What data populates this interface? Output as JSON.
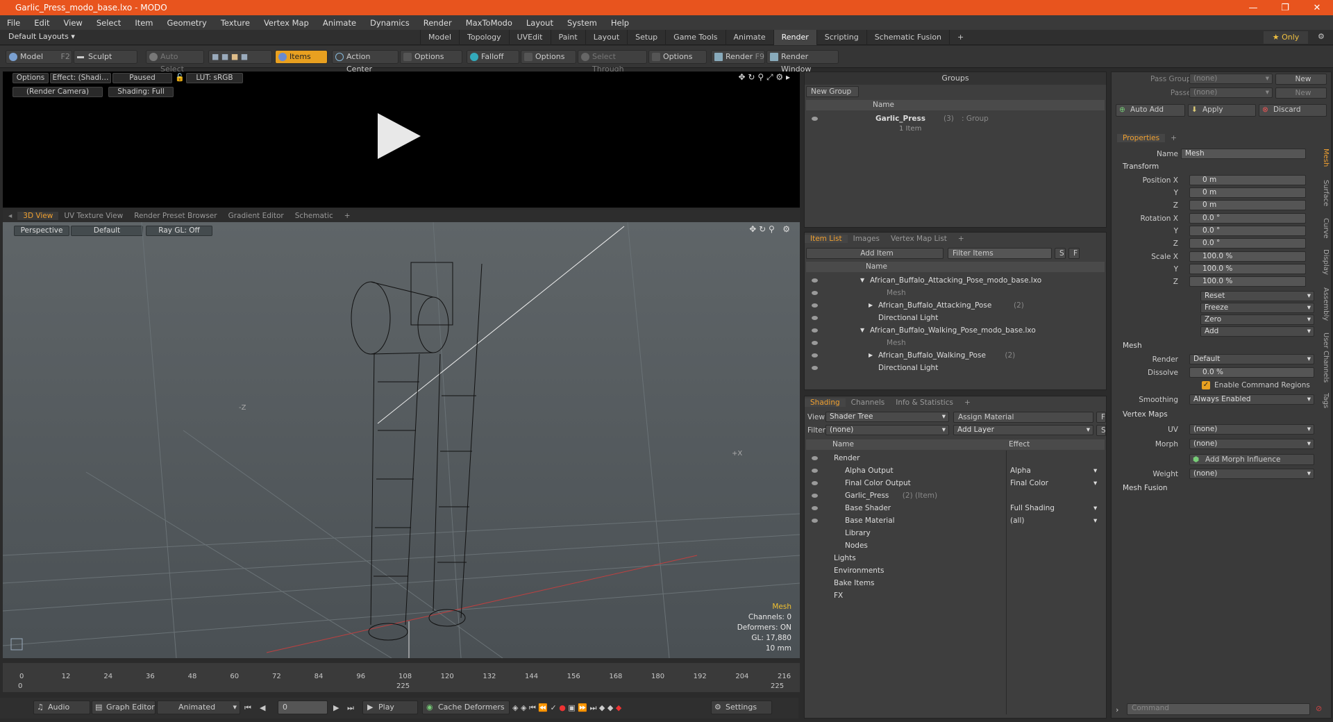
{
  "window": {
    "title": "Garlic_Press_modo_base.lxo - MODO",
    "controls": [
      "—",
      "❐",
      "✕"
    ]
  },
  "menu": [
    "File",
    "Edit",
    "View",
    "Select",
    "Item",
    "Geometry",
    "Texture",
    "Vertex Map",
    "Animate",
    "Dynamics",
    "Render",
    "MaxToModo",
    "Layout",
    "System",
    "Help"
  ],
  "layout": {
    "default": "Default Layouts",
    "tabs": [
      "Model",
      "Topology",
      "UVEdit",
      "Paint",
      "Layout",
      "Setup",
      "Game Tools",
      "Animate",
      "Render",
      "Scripting",
      "Schematic Fusion"
    ],
    "active_tab": "Render",
    "plus": "+",
    "only": "Only"
  },
  "toolbar": {
    "model": "Model",
    "model_key": "F2",
    "sculpt": "Sculpt",
    "auto_select": "Auto Select",
    "items": "Items",
    "action_center": "Action Center",
    "options1": "Options",
    "falloff": "Falloff",
    "options2": "Options",
    "select_through": "Select Through",
    "options3": "Options",
    "render": "Render",
    "render_key": "F9",
    "render_window": "Render Window"
  },
  "render_view": {
    "options": "Options",
    "effect": "Effect: (Shadi…",
    "paused": "Paused",
    "lut": "LUT: sRGB",
    "camera": "(Render Camera)",
    "shading": "Shading: Full"
  },
  "viewport_tabs": [
    "3D View",
    "UV Texture View",
    "Render Preset Browser",
    "Gradient Editor",
    "Schematic",
    "+"
  ],
  "view3d": {
    "perspective": "Perspective",
    "default": "Default",
    "raygl": "Ray GL: Off",
    "hud": {
      "item": "Mesh",
      "channels": "Channels: 0",
      "deformers": "Deformers: ON",
      "gl": "GL: 17,880",
      "size": "10 mm"
    }
  },
  "timeline": {
    "ticks": [
      "0",
      "12",
      "24",
      "36",
      "48",
      "60",
      "72",
      "84",
      "96",
      "108",
      "120",
      "132",
      "144",
      "156",
      "168",
      "180",
      "192",
      "204",
      "216"
    ],
    "start": "0",
    "mid": "225",
    "end": "225"
  },
  "bottombar": {
    "audio": "Audio",
    "graph_editor": "Graph Editor",
    "animated": "Animated",
    "frame": "0",
    "play": "Play",
    "cache": "Cache Deformers",
    "settings": "Settings"
  },
  "groups": {
    "title": "Groups",
    "new_group": "New Group",
    "col_name": "Name",
    "item_name": "Garlic_Press",
    "item_count": "(3)",
    "item_type": ": Group",
    "item_sub": "1 Item"
  },
  "item_list": {
    "tabs": [
      "Item List",
      "Images",
      "Vertex Map List",
      "+"
    ],
    "add_item": "Add Item",
    "filter": "Filter Items",
    "s": "S",
    "f": "F",
    "col_name": "Name",
    "rows": [
      {
        "label": "African_Buffalo_Attacking_Pose_modo_base.lxo",
        "indent": 0,
        "dim": false,
        "exp": "▼"
      },
      {
        "label": "Mesh",
        "indent": 2,
        "dim": true,
        "exp": ""
      },
      {
        "label": "African_Buffalo_Attacking_Pose",
        "suffix": "(2)",
        "indent": 1,
        "dim": false,
        "exp": "▶"
      },
      {
        "label": "Directional Light",
        "indent": 1,
        "dim": false,
        "exp": ""
      },
      {
        "label": "African_Buffalo_Walking_Pose_modo_base.lxo",
        "indent": 0,
        "dim": false,
        "exp": "▼"
      },
      {
        "label": "Mesh",
        "indent": 2,
        "dim": true,
        "exp": ""
      },
      {
        "label": "African_Buffalo_Walking_Pose",
        "suffix": "(2)",
        "indent": 1,
        "dim": false,
        "exp": "▶"
      },
      {
        "label": "Directional Light",
        "indent": 1,
        "dim": false,
        "exp": ""
      }
    ]
  },
  "shading": {
    "tabs": [
      "Shading",
      "Channels",
      "Info & Statistics",
      "+"
    ],
    "view_label": "View",
    "view_value": "Shader Tree",
    "assign": "Assign Material",
    "f": "F",
    "filter_label": "Filter",
    "filter_value": "(none)",
    "add_layer": "Add Layer",
    "s": "S",
    "col_name": "Name",
    "col_effect": "Effect",
    "rows": [
      {
        "name": "Render",
        "effect": "",
        "indent": 0
      },
      {
        "name": "Alpha Output",
        "effect": "Alpha",
        "indent": 1
      },
      {
        "name": "Final Color Output",
        "effect": "Final Color",
        "indent": 1
      },
      {
        "name": "Garlic_Press",
        "suffix": "(2) (Item)",
        "effect": "",
        "indent": 1
      },
      {
        "name": "Base Shader",
        "effect": "Full Shading",
        "indent": 1
      },
      {
        "name": "Base Material",
        "effect": "(all)",
        "indent": 1
      },
      {
        "name": "Library",
        "effect": "",
        "indent": 1
      },
      {
        "name": "Nodes",
        "effect": "",
        "indent": 1
      },
      {
        "name": "Lights",
        "effect": "",
        "indent": 0
      },
      {
        "name": "Environments",
        "effect": "",
        "indent": 0
      },
      {
        "name": "Bake Items",
        "effect": "",
        "indent": 0
      },
      {
        "name": "FX",
        "effect": "",
        "indent": 0
      }
    ]
  },
  "passes": {
    "pass_groups": "Pass Groups",
    "pass_value": "(none)",
    "passes": "Passes",
    "passes_value": "(none)",
    "new": "New",
    "auto_add": "Auto Add",
    "apply": "Apply",
    "discard": "Discard"
  },
  "properties": {
    "tab": "Properties",
    "plus": "+",
    "name_label": "Name",
    "name_value": "Mesh",
    "transform": "Transform",
    "position_label": "Position X",
    "pos": [
      "0 m",
      "0 m",
      "0 m"
    ],
    "rotation_label": "Rotation X",
    "rot": [
      "0.0 °",
      "0.0 °",
      "0.0 °"
    ],
    "scale_label": "Scale X",
    "scl": [
      "100.0 %",
      "100.0 %",
      "100.0 %"
    ],
    "axes": [
      "Y",
      "Z"
    ],
    "actions": [
      "Reset",
      "Freeze",
      "Zero",
      "Add"
    ],
    "mesh": "Mesh",
    "render_label": "Render",
    "render_value": "Default",
    "dissolve_label": "Dissolve",
    "dissolve_value": "0.0 %",
    "cmd_regions": "Enable Command Regions",
    "smoothing_label": "Smoothing",
    "smoothing_value": "Always Enabled",
    "vertex_maps": "Vertex Maps",
    "uv_label": "UV",
    "uv_value": "(none)",
    "morph_label": "Morph",
    "morph_value": "(none)",
    "add_morph": "Add Morph Influence",
    "weight_label": "Weight",
    "weight_value": "(none)",
    "mesh_fusion": "Mesh Fusion",
    "side_tabs": [
      "Mesh",
      "Surface",
      "Curve",
      "Display",
      "Assembly",
      "User Channels",
      "Tags"
    ],
    "command": "Command"
  },
  "colors": {
    "accent": "#e8541e",
    "orange": "#f0a030",
    "yellow": "#f0c030"
  }
}
